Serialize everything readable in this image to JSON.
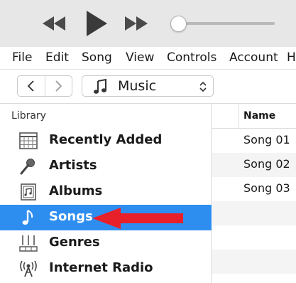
{
  "transport": {
    "previous_icon": "rewind-icon",
    "play_icon": "play-icon",
    "next_icon": "fast-forward-icon",
    "volume_level": 0.08
  },
  "menu": {
    "items": [
      "File",
      "Edit",
      "Song",
      "View",
      "Controls",
      "Account",
      "H"
    ]
  },
  "nav": {
    "back_icon": "chevron-left-icon",
    "forward_icon": "chevron-right-icon",
    "media_type": "Music",
    "media_icon": "music-note-icon"
  },
  "sidebar": {
    "header": "Library",
    "items": [
      {
        "label": "Recently Added",
        "icon": "calendar-grid-icon",
        "selected": false
      },
      {
        "label": "Artists",
        "icon": "microphone-icon",
        "selected": false
      },
      {
        "label": "Albums",
        "icon": "album-icon",
        "selected": false
      },
      {
        "label": "Songs",
        "icon": "music-note-icon",
        "selected": true
      },
      {
        "label": "Genres",
        "icon": "guitar-icon",
        "selected": false
      },
      {
        "label": "Internet Radio",
        "icon": "radio-antenna-icon",
        "selected": false
      }
    ],
    "selected_color": "#2e8ef0"
  },
  "songs": {
    "column_header": "Name",
    "rows": [
      "Song 01",
      "Song 02",
      "Song 03"
    ]
  },
  "annotation": {
    "arrow_color": "#e8202a"
  }
}
